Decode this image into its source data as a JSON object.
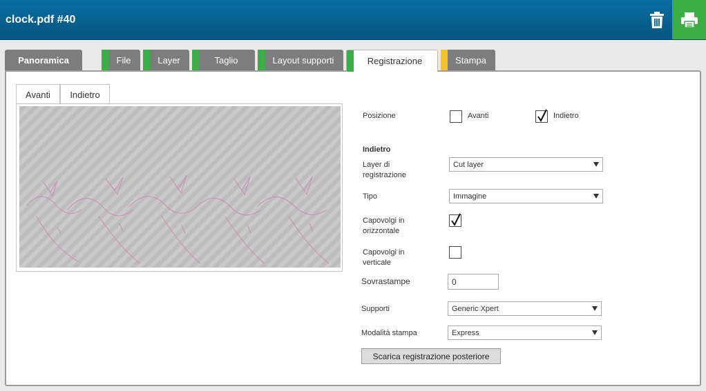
{
  "header": {
    "title": "clock.pdf #40",
    "icons": {
      "delete": "trash-icon",
      "print": "printer-icon"
    },
    "colors": {
      "bar": "#0a6ea2",
      "print_bg": "#3cae46"
    }
  },
  "tabs": [
    {
      "label": "Panoramica",
      "status": "none"
    },
    {
      "label": "File",
      "status": "green"
    },
    {
      "label": "Layer",
      "status": "green"
    },
    {
      "label": "Taglio",
      "status": "green"
    },
    {
      "label": "Layout supporti",
      "status": "green"
    },
    {
      "label": "Registrazione",
      "status": "green",
      "active": true
    },
    {
      "label": "Stampa",
      "status": "yellow"
    }
  ],
  "status_colors": {
    "green": "#3cae46",
    "yellow": "#f2c230"
  },
  "subtabs": {
    "front": "Avanti",
    "back": "Indietro",
    "active": "back"
  },
  "form": {
    "position_label": "Posizione",
    "position_front_label": "Avanti",
    "position_front_checked": false,
    "position_back_label": "Indietro",
    "position_back_checked": true,
    "section_title": "Indietro",
    "reg_layer_label": "Layer di registrazione",
    "reg_layer_value": "Cut layer",
    "type_label": "Tipo",
    "type_value": "Immagine",
    "flip_h_label": "Capovolgi in orizzontale",
    "flip_h_checked": true,
    "flip_v_label": "Capovolgi in verticale",
    "flip_v_checked": false,
    "overprint_label": "Sovrastampe",
    "overprint_value": "0",
    "media_label": "Supporti",
    "media_value": "Generic Xpert",
    "print_mode_label": "Modalità stampa",
    "print_mode_value": "Express",
    "download_button": "Scarica registrazione posteriore"
  }
}
